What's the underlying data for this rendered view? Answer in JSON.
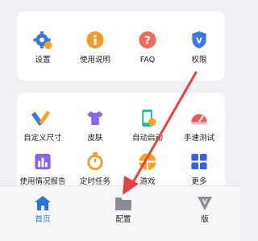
{
  "top_grid": {
    "items": [
      {
        "label": "设置",
        "icon": "gear-icon"
      },
      {
        "label": "使用说明",
        "icon": "info-icon"
      },
      {
        "label": "FAQ",
        "icon": "question-icon"
      },
      {
        "label": "权限",
        "icon": "shield-icon"
      }
    ]
  },
  "tools_grid": {
    "items": [
      {
        "label": "自定义尺寸",
        "icon": "ruler-pencil-icon"
      },
      {
        "label": "皮肤",
        "icon": "shirt-icon"
      },
      {
        "label": "自动启动",
        "icon": "phone-power-icon"
      },
      {
        "label": "手速测试",
        "icon": "speedometer-icon"
      },
      {
        "label": "使用情况报告",
        "icon": "bar-chart-icon"
      },
      {
        "label": "定时任务",
        "icon": "timer-icon"
      },
      {
        "label": "游戏",
        "icon": "game-icon"
      },
      {
        "label": "更多",
        "icon": "grid-icon"
      }
    ]
  },
  "bottom_nav": {
    "items": [
      {
        "label": "首页",
        "icon": "home-icon",
        "active": true
      },
      {
        "label": "配置",
        "icon": "folder-icon",
        "active": false
      },
      {
        "label": "版",
        "icon": "v-badge-icon",
        "active": false
      }
    ]
  },
  "colors": {
    "active": "#2f6fe4",
    "inactive": "#8c8c96",
    "annotation": "#e8423f"
  }
}
